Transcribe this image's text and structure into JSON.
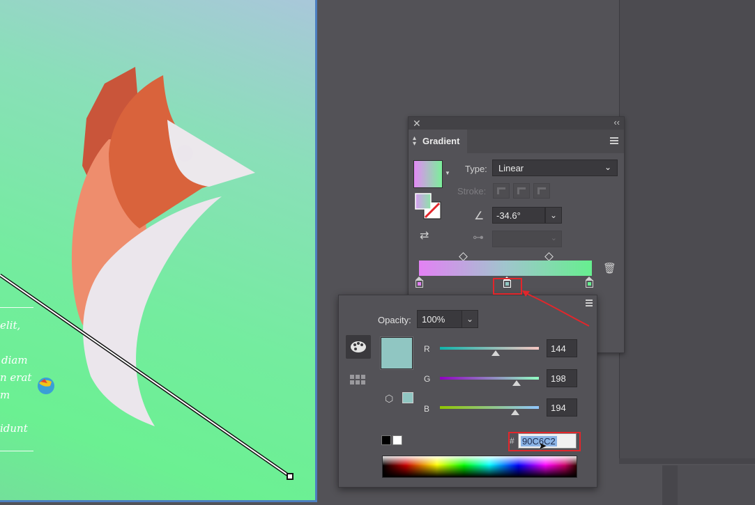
{
  "canvas": {
    "body_text_lines": [
      "elit,",
      "diam",
      "n erat",
      "m",
      "idunt"
    ]
  },
  "gradient_panel": {
    "tab_title": "Gradient",
    "type_label": "Type:",
    "type_value": "Linear",
    "stroke_label": "Stroke:",
    "angle_value": "-34.6°",
    "aspect_value": "",
    "gradient_start_color": "#e381f4",
    "gradient_mid_color": "#a0c5cd",
    "gradient_end_color": "#66ef8f"
  },
  "color_popup": {
    "opacity_label": "Opacity:",
    "opacity_value": "100%",
    "r_label": "R",
    "g_label": "G",
    "b_label": "B",
    "r_value": "144",
    "g_value": "198",
    "b_value": "194",
    "r_fraction": 0.565,
    "g_fraction": 0.776,
    "b_fraction": 0.761,
    "hex_symbol": "#",
    "hex_value": "90C6C2",
    "current_color": "#90c6c2"
  },
  "icons": [
    "close-icon",
    "collapse-icon",
    "panel-menu-icon",
    "reverse-gradient-icon",
    "angle-icon",
    "aspect-ratio-icon",
    "trash-icon",
    "color-mode-icon",
    "swatches-icon",
    "out-of-gamut-cube-icon",
    "cursor-icon",
    "earth-icon"
  ],
  "annotation_color": "#e3262b"
}
